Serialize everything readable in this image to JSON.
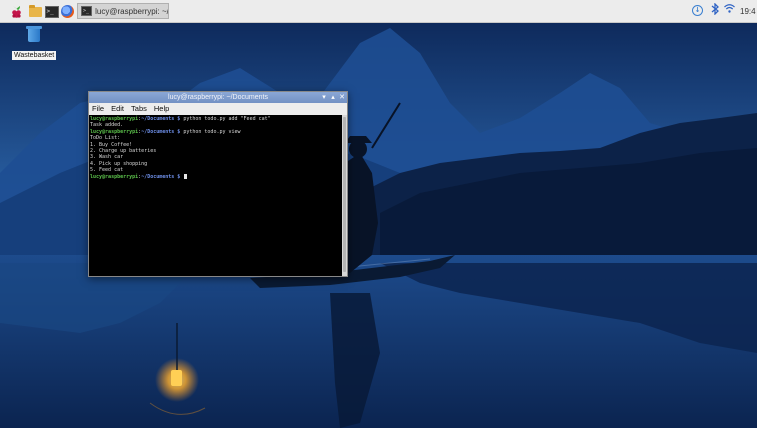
{
  "taskbar": {
    "icons": [
      "raspberry-menu-icon",
      "folder-icon",
      "terminal-icon",
      "web-browser-icon"
    ],
    "window_button_label": "lucy@raspberrypi: ~/...",
    "tray_icons": [
      "updates-icon",
      "bluetooth-icon",
      "wifi-icon"
    ],
    "clock": "19:4"
  },
  "desktop": {
    "wallpaper": "night river with boat and lantern",
    "icons": [
      {
        "label": "Wastebasket",
        "icon": "trash-icon"
      }
    ]
  },
  "terminal": {
    "title": "lucy@raspberrypi: ~/Documents",
    "menu": [
      "File",
      "Edit",
      "Tabs",
      "Help"
    ],
    "lines": [
      {
        "prompt_user": "lucy@raspberrypi",
        "prompt_sep": ":",
        "prompt_path": "~/Documents $",
        "text": " python todo.py add \"Feed cat\""
      },
      {
        "prompt_user": "",
        "prompt_sep": "",
        "prompt_path": "",
        "text": "Task added."
      },
      {
        "prompt_user": "lucy@raspberrypi",
        "prompt_sep": ":",
        "prompt_path": "~/Documents $",
        "text": " python todo.py view"
      },
      {
        "prompt_user": "",
        "prompt_sep": "",
        "prompt_path": "",
        "text": "ToDo List:"
      },
      {
        "prompt_user": "",
        "prompt_sep": "",
        "prompt_path": "",
        "text": "1. Buy Coffee!"
      },
      {
        "prompt_user": "",
        "prompt_sep": "",
        "prompt_path": "",
        "text": "2. Charge up batteries"
      },
      {
        "prompt_user": "",
        "prompt_sep": "",
        "prompt_path": "",
        "text": "3. Wash car"
      },
      {
        "prompt_user": "",
        "prompt_sep": "",
        "prompt_path": "",
        "text": "4. Pick up shopping"
      },
      {
        "prompt_user": "",
        "prompt_sep": "",
        "prompt_path": "",
        "text": "5. Feed cat"
      },
      {
        "prompt_user": "lucy@raspberrypi",
        "prompt_sep": ":",
        "prompt_path": "~/Documents $",
        "text": " "
      }
    ],
    "colors": {
      "background": "#000000",
      "text": "#d8d8d8",
      "prompt_user": "#5cc24b",
      "prompt_path": "#6e8fe8"
    }
  }
}
